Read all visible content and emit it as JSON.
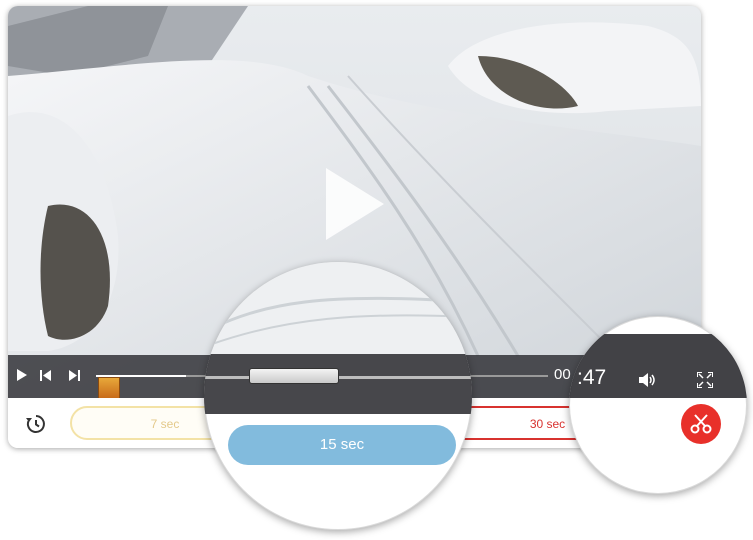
{
  "player": {
    "time_visible": "00",
    "progress_percent": 20
  },
  "pills": {
    "seven": "7 sec",
    "fifteen": "15 sec",
    "thirty": "30 sec"
  },
  "magnifier_right": {
    "time_fragment": ":47"
  },
  "icons": {
    "play": "play-icon",
    "prev": "skip-previous-icon",
    "next": "skip-next-icon",
    "history": "history-icon",
    "volume": "volume-icon",
    "fullscreen": "fullscreen-icon",
    "cut": "scissors-icon"
  },
  "colors": {
    "accent_red": "#d8322f",
    "pill_blue": "#82bbdd",
    "pill_yellow_border": "#f3e2a6"
  }
}
